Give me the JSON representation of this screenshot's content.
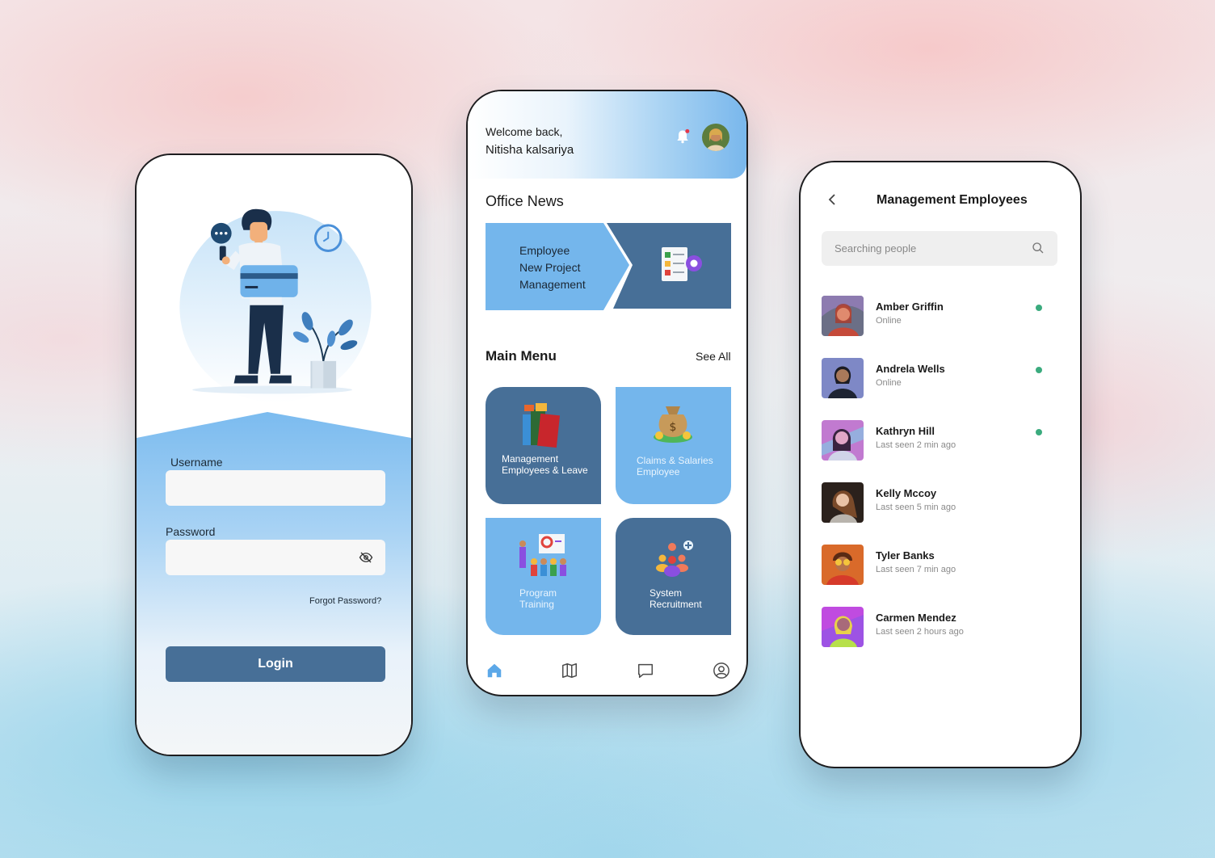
{
  "login": {
    "username_label": "Username",
    "username_value": "",
    "password_label": "Password",
    "password_value": "",
    "forgot_label": "Forgot Password?",
    "login_label": "Login"
  },
  "home": {
    "welcome": "Welcome back,",
    "user_name": "Nitisha kalsariya",
    "office_news_title": "Office News",
    "news_line1": "Employee",
    "news_line2": "New Project",
    "news_line3": "Management",
    "main_menu_title": "Main Menu",
    "see_all": "See All",
    "tiles": [
      {
        "line1": "Management",
        "line2": "Employees & Leave"
      },
      {
        "line1": "Claims & Salaries",
        "line2": "Employee"
      },
      {
        "line1": "Program",
        "line2": "Training"
      },
      {
        "line1": "System",
        "line2": "Recruitment"
      }
    ],
    "colors": {
      "dark_tile": "#476f97",
      "light_tile": "#74b6ec",
      "accent": "#79b7ec"
    }
  },
  "employees": {
    "title": "Management Employees",
    "search_placeholder": "Searching people",
    "people": [
      {
        "name": "Amber Griffin",
        "status": "Online"
      },
      {
        "name": "Andrela Wells",
        "status": "Online"
      },
      {
        "name": "Kathryn Hill",
        "status": "Last seen 2 min ago"
      },
      {
        "name": "Kelly Mccoy",
        "status": "Last seen 5 min ago"
      },
      {
        "name": "Tyler Banks",
        "status": "Last seen 7 min ago"
      },
      {
        "name": "Carmen Mendez",
        "status": "Last seen 2 hours ago"
      }
    ],
    "online_color": "#3bab7e"
  }
}
